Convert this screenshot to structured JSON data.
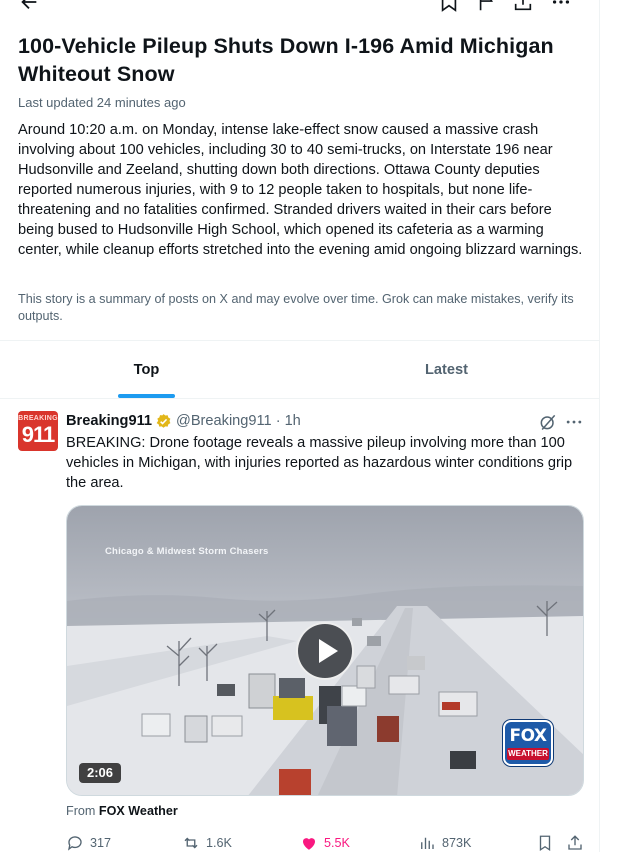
{
  "headline": "100-Vehicle Pileup Shuts Down I-196 Amid Michigan Whiteout Snow",
  "last_updated": "Last updated 24 minutes ago",
  "summary": "Around 10:20 a.m. on Monday, intense lake-effect snow caused a massive crash involving about 100 vehicles, including 30 to 40 semi-trucks, on Interstate 196 near Hudsonville and Zeeland, shutting down both directions. Ottawa County deputies reported numerous injuries, with 9 to 12 people taken to hospitals, but none life-threatening and no fatalities confirmed. Stranded drivers waited in their cars before being bused to Hudsonville High School, which opened its cafeteria as a warming center, while cleanup efforts stretched into the evening amid ongoing blizzard warnings.",
  "disclaimer": "This story is a summary of posts on X and may evolve over time. Grok can make mistakes, verify its outputs.",
  "tabs": {
    "top": "Top",
    "latest": "Latest",
    "active": "Top"
  },
  "post": {
    "author_name": "Breaking911",
    "handle": "@Breaking911",
    "separator": "·",
    "time": "1h",
    "avatar_text_top": "BREAKING",
    "avatar_text_main": "911",
    "text": "BREAKING: Drone footage reveals a massive pileup involving more than 100 vehicles in Michigan, with injuries reported as hazardous winter conditions grip the area.",
    "media": {
      "caption": "Chicago & Midwest Storm Chasers",
      "duration": "2:06",
      "logo_line1": "FOX",
      "logo_line2": "WEATHER"
    },
    "from_label": "From",
    "from_source": "FOX Weather",
    "stats": {
      "replies": "317",
      "reposts": "1.6K",
      "likes": "5.5K",
      "views": "873K"
    }
  },
  "colors": {
    "accent": "#1d9bf0",
    "like": "#f91880",
    "verified": "#e2b719",
    "secondary_text": "#536471"
  },
  "icons": [
    "back-arrow-icon",
    "bookmark-icon",
    "flag-icon",
    "share-icon",
    "more-icon",
    "verified-badge-icon",
    "grok-icon",
    "play-icon",
    "reply-icon",
    "repost-icon",
    "like-icon",
    "views-icon"
  ]
}
